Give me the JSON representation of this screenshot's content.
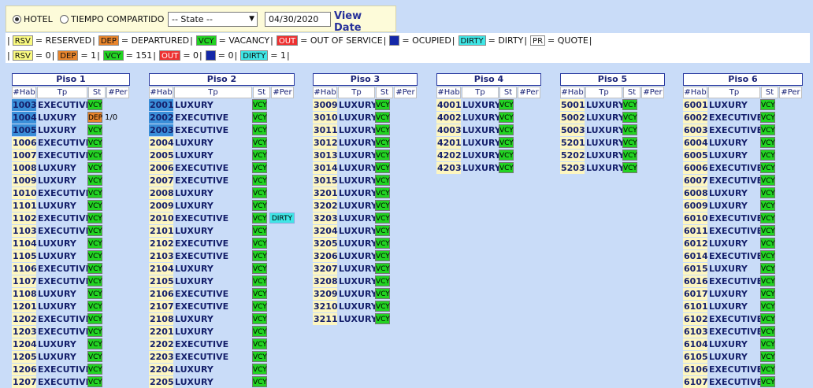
{
  "topbar": {
    "radio_hotel": "HOTEL",
    "radio_timeshare": "TIEMPO COMPARTIDO",
    "state_select": "-- State --",
    "date_value": "04/30/2020",
    "view_date_label": "View Date"
  },
  "legend": {
    "rsv": "RSV",
    "rsv_text": "= RESERVED",
    "dep": "DEP",
    "dep_text": "= DEPARTURED",
    "vcy": "VCY",
    "vcy_text": "= VACANCY",
    "out": "OUT",
    "out_text": "= OUT OF SERVICE",
    "ocu_text": "= OCUPIED",
    "dirty": "DIRTY",
    "dirty_text": "= DIRTY",
    "pr": "PR",
    "pr_text": "= QUOTE",
    "sep": "|"
  },
  "counts": {
    "rsv": "= 0",
    "dep": "= 1",
    "vcy": "= 151",
    "out": "= 0",
    "ocu": "= 0",
    "dirty": "= 1"
  },
  "columns": {
    "hab": "#Hab",
    "tp": "Tp",
    "st": "St",
    "per": "#Per"
  },
  "floors": [
    {
      "title": "Piso 1",
      "rooms": [
        {
          "hab": "1003",
          "tp": "EXECUTIVE",
          "st": "VCY",
          "hab_state": "ocu"
        },
        {
          "hab": "1004",
          "tp": "LUXURY",
          "st": "DEP",
          "per": "1/0",
          "hab_state": "ocu"
        },
        {
          "hab": "1005",
          "tp": "LUXURY",
          "st": "VCY",
          "hab_state": "ocu"
        },
        {
          "hab": "1006",
          "tp": "EXECUTIVE",
          "st": "VCY"
        },
        {
          "hab": "1007",
          "tp": "EXECUTIVE",
          "st": "VCY"
        },
        {
          "hab": "1008",
          "tp": "LUXURY",
          "st": "VCY"
        },
        {
          "hab": "1009",
          "tp": "LUXURY",
          "st": "VCY"
        },
        {
          "hab": "1010",
          "tp": "EXECUTIVE",
          "st": "VCY"
        },
        {
          "hab": "1101",
          "tp": "LUXURY",
          "st": "VCY"
        },
        {
          "hab": "1102",
          "tp": "EXECUTIVE",
          "st": "VCY"
        },
        {
          "hab": "1103",
          "tp": "EXECUTIVE",
          "st": "VCY"
        },
        {
          "hab": "1104",
          "tp": "LUXURY",
          "st": "VCY"
        },
        {
          "hab": "1105",
          "tp": "LUXURY",
          "st": "VCY"
        },
        {
          "hab": "1106",
          "tp": "EXECUTIVE",
          "st": "VCY"
        },
        {
          "hab": "1107",
          "tp": "EXECUTIVE",
          "st": "VCY"
        },
        {
          "hab": "1108",
          "tp": "LUXURY",
          "st": "VCY"
        },
        {
          "hab": "1201",
          "tp": "LUXURY",
          "st": "VCY"
        },
        {
          "hab": "1202",
          "tp": "EXECUTIVE",
          "st": "VCY"
        },
        {
          "hab": "1203",
          "tp": "EXECUTIVE",
          "st": "VCY"
        },
        {
          "hab": "1204",
          "tp": "LUXURY",
          "st": "VCY"
        },
        {
          "hab": "1205",
          "tp": "LUXURY",
          "st": "VCY"
        },
        {
          "hab": "1206",
          "tp": "EXECUTIVE",
          "st": "VCY"
        },
        {
          "hab": "1207",
          "tp": "EXECUTIVE",
          "st": "VCY"
        }
      ]
    },
    {
      "title": "Piso 2",
      "rooms": [
        {
          "hab": "2001",
          "tp": "LUXURY",
          "st": "VCY",
          "hab_state": "ocu"
        },
        {
          "hab": "2002",
          "tp": "EXECUTIVE",
          "st": "VCY",
          "hab_state": "ocu"
        },
        {
          "hab": "2003",
          "tp": "EXECUTIVE",
          "st": "VCY",
          "hab_state": "ocu"
        },
        {
          "hab": "2004",
          "tp": "LUXURY",
          "st": "VCY"
        },
        {
          "hab": "2005",
          "tp": "LUXURY",
          "st": "VCY"
        },
        {
          "hab": "2006",
          "tp": "EXECUTIVE",
          "st": "VCY"
        },
        {
          "hab": "2007",
          "tp": "EXECUTIVE",
          "st": "VCY"
        },
        {
          "hab": "2008",
          "tp": "LUXURY",
          "st": "VCY"
        },
        {
          "hab": "2009",
          "tp": "LUXURY",
          "st": "VCY"
        },
        {
          "hab": "2010",
          "tp": "EXECUTIVE",
          "st": "VCY",
          "dirty": "DIRTY"
        },
        {
          "hab": "2101",
          "tp": "LUXURY",
          "st": "VCY"
        },
        {
          "hab": "2102",
          "tp": "EXECUTIVE",
          "st": "VCY"
        },
        {
          "hab": "2103",
          "tp": "EXECUTIVE",
          "st": "VCY"
        },
        {
          "hab": "2104",
          "tp": "LUXURY",
          "st": "VCY"
        },
        {
          "hab": "2105",
          "tp": "LUXURY",
          "st": "VCY"
        },
        {
          "hab": "2106",
          "tp": "EXECUTIVE",
          "st": "VCY"
        },
        {
          "hab": "2107",
          "tp": "EXECUTIVE",
          "st": "VCY"
        },
        {
          "hab": "2108",
          "tp": "LUXURY",
          "st": "VCY"
        },
        {
          "hab": "2201",
          "tp": "LUXURY",
          "st": "VCY"
        },
        {
          "hab": "2202",
          "tp": "EXECUTIVE",
          "st": "VCY"
        },
        {
          "hab": "2203",
          "tp": "EXECUTIVE",
          "st": "VCY"
        },
        {
          "hab": "2204",
          "tp": "LUXURY",
          "st": "VCY"
        },
        {
          "hab": "2205",
          "tp": "LUXURY",
          "st": "VCY"
        }
      ]
    },
    {
      "title": "Piso 3",
      "rooms": [
        {
          "hab": "3009",
          "tp": "LUXURY",
          "st": "VCY"
        },
        {
          "hab": "3010",
          "tp": "LUXURY",
          "st": "VCY"
        },
        {
          "hab": "3011",
          "tp": "LUXURY",
          "st": "VCY"
        },
        {
          "hab": "3012",
          "tp": "LUXURY",
          "st": "VCY"
        },
        {
          "hab": "3013",
          "tp": "LUXURY",
          "st": "VCY"
        },
        {
          "hab": "3014",
          "tp": "LUXURY",
          "st": "VCY"
        },
        {
          "hab": "3015",
          "tp": "LUXURY",
          "st": "VCY"
        },
        {
          "hab": "3201",
          "tp": "LUXURY",
          "st": "VCY"
        },
        {
          "hab": "3202",
          "tp": "LUXURY",
          "st": "VCY"
        },
        {
          "hab": "3203",
          "tp": "LUXURY",
          "st": "VCY"
        },
        {
          "hab": "3204",
          "tp": "LUXURY",
          "st": "VCY"
        },
        {
          "hab": "3205",
          "tp": "LUXURY",
          "st": "VCY"
        },
        {
          "hab": "3206",
          "tp": "LUXURY",
          "st": "VCY"
        },
        {
          "hab": "3207",
          "tp": "LUXURY",
          "st": "VCY"
        },
        {
          "hab": "3208",
          "tp": "LUXURY",
          "st": "VCY"
        },
        {
          "hab": "3209",
          "tp": "LUXURY",
          "st": "VCY"
        },
        {
          "hab": "3210",
          "tp": "LUXURY",
          "st": "VCY"
        },
        {
          "hab": "3211",
          "tp": "LUXURY",
          "st": "VCY"
        }
      ]
    },
    {
      "title": "Piso 4",
      "rooms": [
        {
          "hab": "4001",
          "tp": "LUXURY",
          "st": "VCY"
        },
        {
          "hab": "4002",
          "tp": "LUXURY",
          "st": "VCY"
        },
        {
          "hab": "4003",
          "tp": "LUXURY",
          "st": "VCY"
        },
        {
          "hab": "4201",
          "tp": "LUXURY",
          "st": "VCY"
        },
        {
          "hab": "4202",
          "tp": "LUXURY",
          "st": "VCY"
        },
        {
          "hab": "4203",
          "tp": "LUXURY",
          "st": "VCY"
        }
      ]
    },
    {
      "title": "Piso 5",
      "rooms": [
        {
          "hab": "5001",
          "tp": "LUXURY",
          "st": "VCY"
        },
        {
          "hab": "5002",
          "tp": "LUXURY",
          "st": "VCY"
        },
        {
          "hab": "5003",
          "tp": "LUXURY",
          "st": "VCY"
        },
        {
          "hab": "5201",
          "tp": "LUXURY",
          "st": "VCY"
        },
        {
          "hab": "5202",
          "tp": "LUXURY",
          "st": "VCY"
        },
        {
          "hab": "5203",
          "tp": "LUXURY",
          "st": "VCY"
        }
      ]
    },
    {
      "title": "Piso 6",
      "rooms": [
        {
          "hab": "6001",
          "tp": "LUXURY",
          "st": "VCY"
        },
        {
          "hab": "6002",
          "tp": "EXECUTIVE",
          "st": "VCY"
        },
        {
          "hab": "6003",
          "tp": "EXECUTIVE",
          "st": "VCY"
        },
        {
          "hab": "6004",
          "tp": "LUXURY",
          "st": "VCY"
        },
        {
          "hab": "6005",
          "tp": "LUXURY",
          "st": "VCY"
        },
        {
          "hab": "6006",
          "tp": "EXECUTIVE",
          "st": "VCY"
        },
        {
          "hab": "6007",
          "tp": "EXECUTIVE",
          "st": "VCY"
        },
        {
          "hab": "6008",
          "tp": "LUXURY",
          "st": "VCY"
        },
        {
          "hab": "6009",
          "tp": "LUXURY",
          "st": "VCY"
        },
        {
          "hab": "6010",
          "tp": "EXECUTIVE",
          "st": "VCY"
        },
        {
          "hab": "6011",
          "tp": "EXECUTIVE",
          "st": "VCY"
        },
        {
          "hab": "6012",
          "tp": "LUXURY",
          "st": "VCY"
        },
        {
          "hab": "6014",
          "tp": "EXECUTIVE",
          "st": "VCY"
        },
        {
          "hab": "6015",
          "tp": "LUXURY",
          "st": "VCY"
        },
        {
          "hab": "6016",
          "tp": "EXECUTIVE",
          "st": "VCY"
        },
        {
          "hab": "6017",
          "tp": "LUXURY",
          "st": "VCY"
        },
        {
          "hab": "6101",
          "tp": "LUXURY",
          "st": "VCY"
        },
        {
          "hab": "6102",
          "tp": "EXECUTIVE",
          "st": "VCY"
        },
        {
          "hab": "6103",
          "tp": "EXECUTIVE",
          "st": "VCY"
        },
        {
          "hab": "6104",
          "tp": "LUXURY",
          "st": "VCY"
        },
        {
          "hab": "6105",
          "tp": "LUXURY",
          "st": "VCY"
        },
        {
          "hab": "6106",
          "tp": "EXECUTIVE",
          "st": "VCY"
        },
        {
          "hab": "6107",
          "tp": "EXECUTIVE",
          "st": "VCY"
        }
      ]
    }
  ]
}
